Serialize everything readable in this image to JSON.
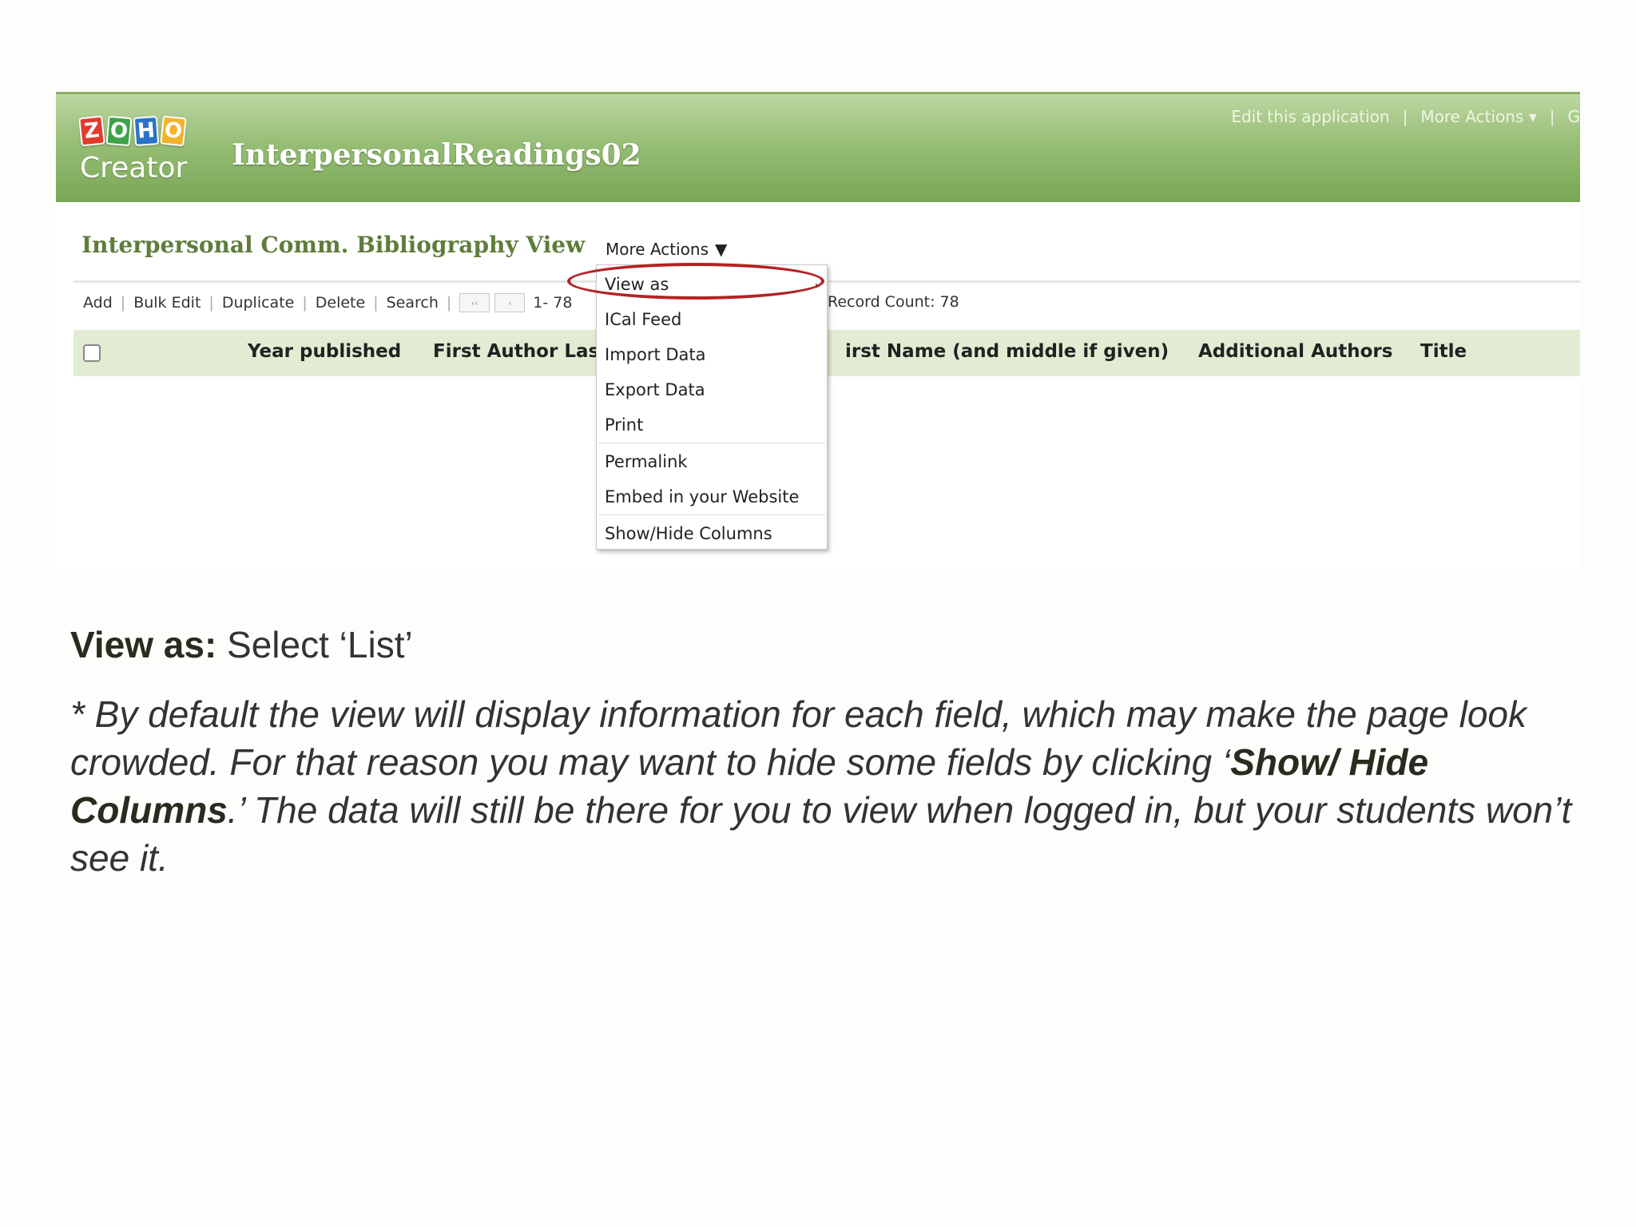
{
  "header": {
    "logo_letters": [
      "Z",
      "O",
      "H",
      "O"
    ],
    "logo_word": "Creator",
    "app_name": "InterpersonalReadings02",
    "links": {
      "edit": "Edit this application",
      "more": "More Actions ▾",
      "sep": "|",
      "extra": "G"
    }
  },
  "view": {
    "title": "Interpersonal Comm. Bibliography View",
    "more_actions": "More Actions",
    "more_actions_caret": "▼"
  },
  "toolbar": {
    "add": "Add",
    "bulk_edit": "Bulk Edit",
    "duplicate": "Duplicate",
    "delete": "Delete",
    "search": "Search",
    "first_glyph": "‹‹",
    "prev_glyph": "‹",
    "range": "1- 78",
    "record_count": "Record Count:  78"
  },
  "columns": [
    "Year published",
    "First Author Last I",
    "irst Name (and middle if given)",
    "Additional Authors",
    "Title"
  ],
  "dropdown": {
    "items": [
      "View as",
      "ICal Feed",
      "Import Data",
      "Export Data",
      "Print",
      "Permalink",
      "Embed in your Website",
      "Show/Hide Columns"
    ],
    "submenu_arrow": "▸"
  },
  "caption": {
    "label": "View as:",
    "text": " Select ‘List’"
  },
  "note": {
    "part1": "* By default the view will display information for each field, which may make the page look crowded. For that reason you may want to hide some fields by clicking ‘",
    "bold": "Show/ Hide Columns",
    "part2": ".’ The data will still be there for you to view when logged in, but your students won’t see it."
  },
  "colors": {
    "header_green": "#79a655",
    "title_green": "#5e7d3b",
    "highlight_red": "#b42222",
    "column_bg": "#e1ecd3"
  }
}
